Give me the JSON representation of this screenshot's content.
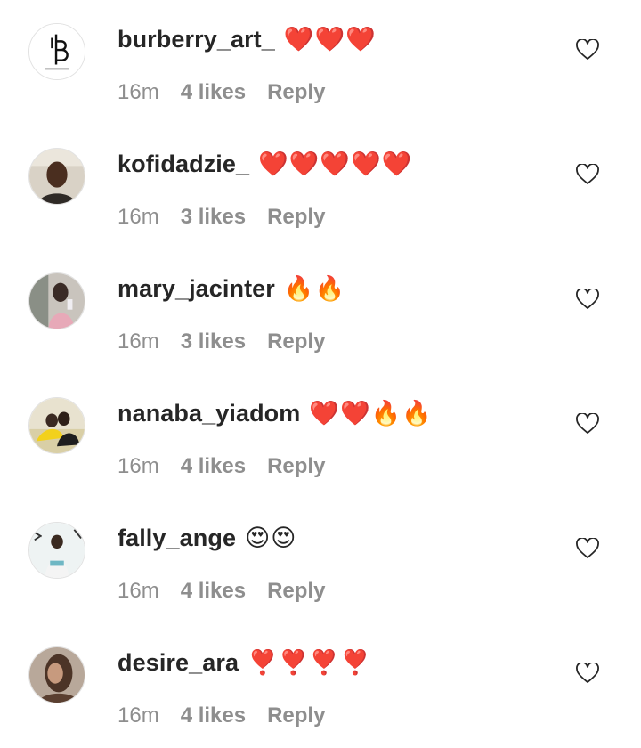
{
  "icons": {
    "like": "heart-outline-icon",
    "emoji_heart": "red-heart-icon",
    "emoji_fire": "fire-icon",
    "emoji_heart_eyes": "heart-eyes-face-icon",
    "emoji_heart_exclamation": "heart-exclamation-icon"
  },
  "colors": {
    "username": "#262626",
    "meta": "#8e8e8e",
    "heart_red": "#dd2e44",
    "background": "#ffffff"
  },
  "comments": [
    {
      "username": "burberry_art_",
      "text": "❤️❤️❤️",
      "time": "16m",
      "likes": "4 likes",
      "reply": "Reply",
      "avatar_caption": "BURBERRY ARTS"
    },
    {
      "username": "kofidadzie_",
      "text": "❤️❤️❤️❤️❤️",
      "time": "16m",
      "likes": "3 likes",
      "reply": "Reply"
    },
    {
      "username": "mary_jacinter",
      "text": "🔥🔥",
      "time": "16m",
      "likes": "3 likes",
      "reply": "Reply"
    },
    {
      "username": "nanaba_yiadom",
      "text": "❤️❤️🔥🔥",
      "time": "16m",
      "likes": "4 likes",
      "reply": "Reply"
    },
    {
      "username": "fally_ange",
      "text": "😍😍",
      "time": "16m",
      "likes": "4 likes",
      "reply": "Reply"
    },
    {
      "username": "desire_ara",
      "text": "❣️❣️❣️❣️",
      "time": "16m",
      "likes": "4 likes",
      "reply": "Reply"
    }
  ]
}
